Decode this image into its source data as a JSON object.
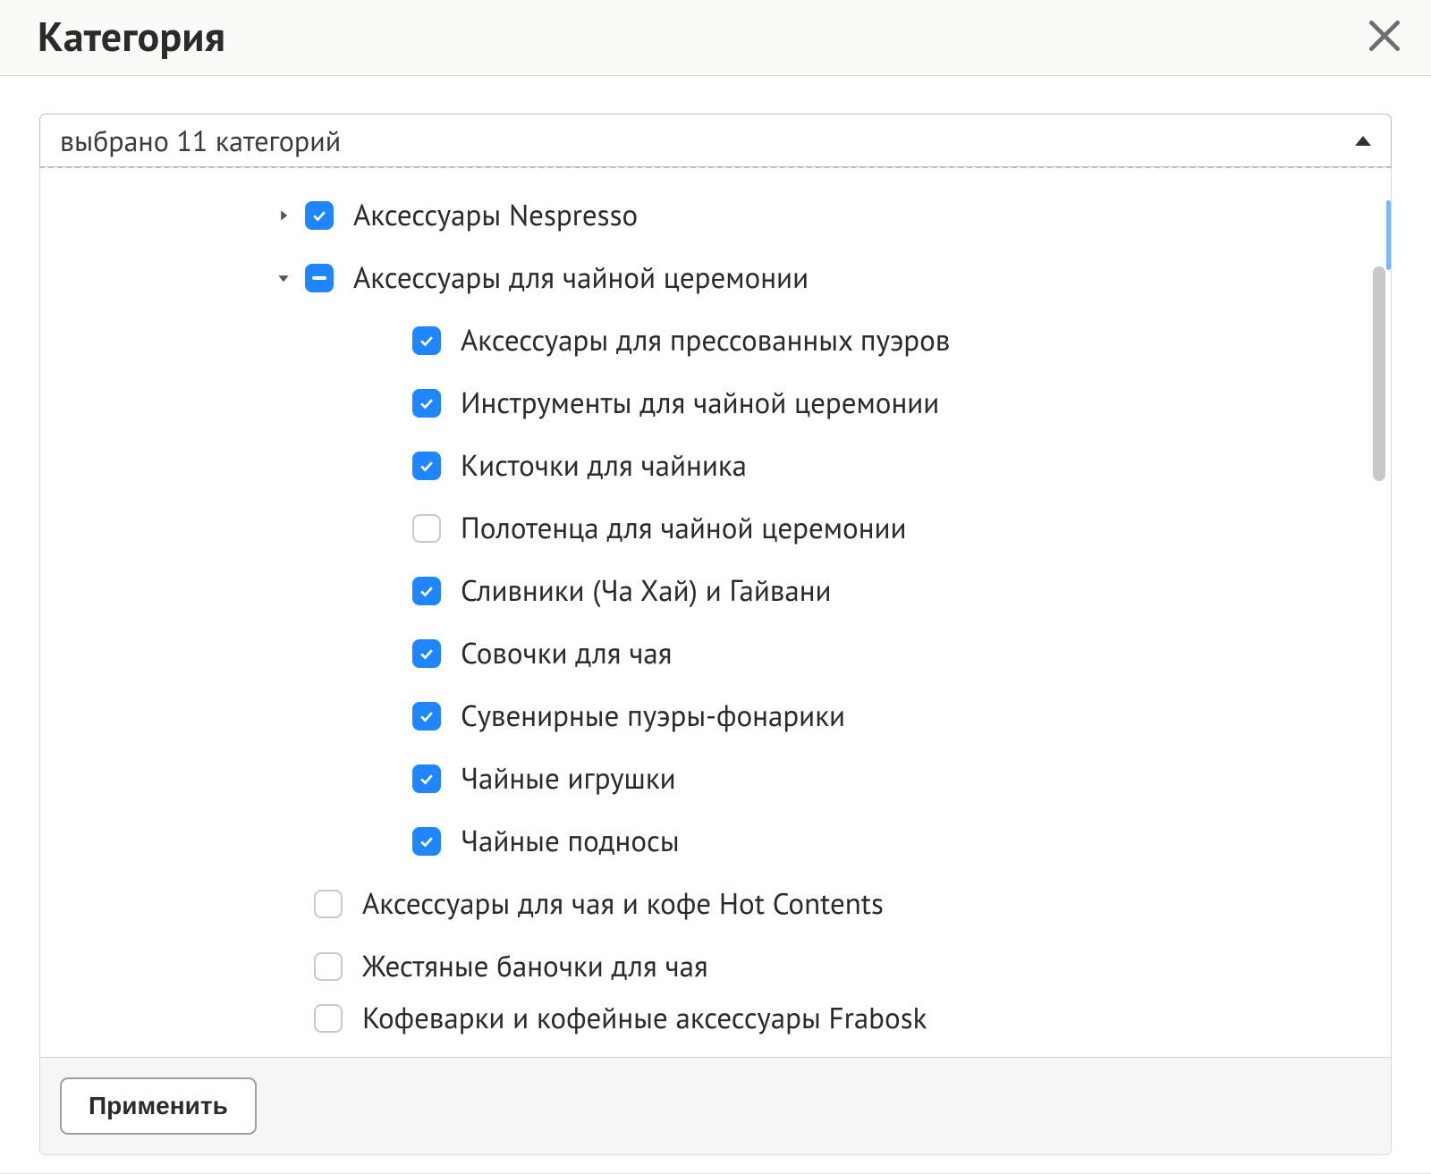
{
  "modal": {
    "title": "Категория",
    "close_icon": "close"
  },
  "selector": {
    "summary": "выбрано 11 категорий"
  },
  "tree": {
    "level1": [
      {
        "id": "nespresso",
        "label": "Аксессуары Nespresso",
        "state": "checked",
        "expandable": true,
        "expanded": false
      },
      {
        "id": "tea-ceremony",
        "label": "Аксессуары для чайной церемонии",
        "state": "mixed",
        "expandable": true,
        "expanded": true,
        "children": [
          {
            "id": "puer-press",
            "label": "Аксессуары для прессованных пуэров",
            "state": "checked"
          },
          {
            "id": "instruments",
            "label": "Инструменты для чайной церемонии",
            "state": "checked"
          },
          {
            "id": "brushes",
            "label": "Кисточки для чайника",
            "state": "checked"
          },
          {
            "id": "towels",
            "label": "Полотенца для чайной церемонии",
            "state": "empty"
          },
          {
            "id": "gaiwan",
            "label": "Сливники (Ча Хай) и Гайвани",
            "state": "checked"
          },
          {
            "id": "scoops",
            "label": "Совочки для чая",
            "state": "checked"
          },
          {
            "id": "souvenir",
            "label": "Сувенирные пуэры-фонарики",
            "state": "checked"
          },
          {
            "id": "tea-toys",
            "label": "Чайные игрушки",
            "state": "checked"
          },
          {
            "id": "tea-trays",
            "label": "Чайные подносы",
            "state": "checked"
          }
        ]
      },
      {
        "id": "hot-contents",
        "label": "Аксессуары для чая и кофе Hot Contents",
        "state": "empty",
        "expandable": false
      },
      {
        "id": "tins",
        "label": "Жестяные баночки для чая",
        "state": "empty",
        "expandable": false
      },
      {
        "id": "frabosk",
        "label": "Кофеварки и кофейные аксессуары Frabosk",
        "state": "empty",
        "expandable": false,
        "clipped": true
      }
    ]
  },
  "footer": {
    "apply_label": "Применить"
  },
  "colors": {
    "accent": "#1f86ff"
  }
}
